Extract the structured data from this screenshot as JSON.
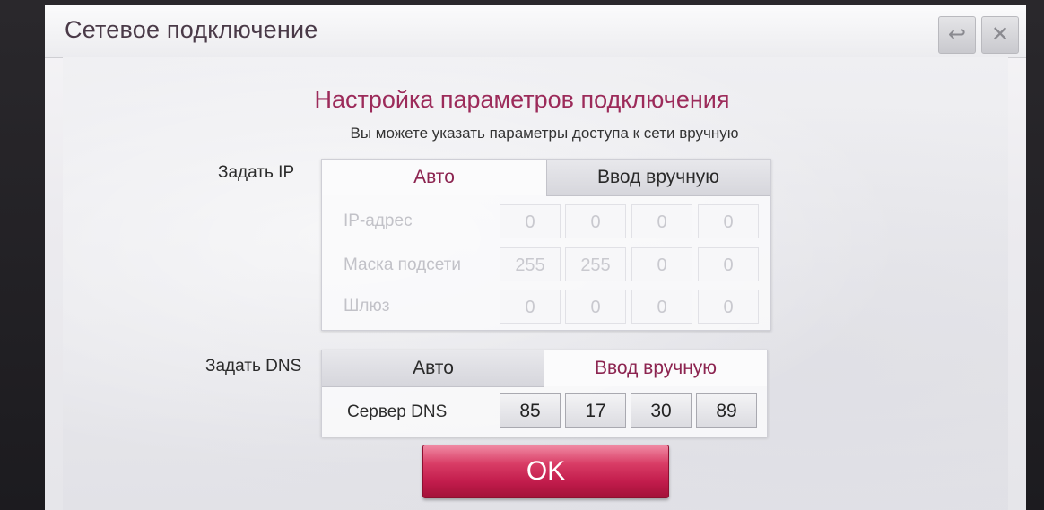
{
  "window": {
    "title": "Сетевое подключение",
    "back_icon": "↩",
    "close_icon": "✕"
  },
  "heading": "Настройка параметров подключения",
  "subheading": "Вы можете указать параметры доступа к сети вручную",
  "ip_section": {
    "label": "Задать IP",
    "tabs": [
      {
        "label": "Авто",
        "selected": true
      },
      {
        "label": "Ввод вручную",
        "selected": false
      }
    ],
    "fields": [
      {
        "label": "IP-адрес",
        "values": [
          "0",
          "0",
          "0",
          "0"
        ]
      },
      {
        "label": "Маска подсети",
        "values": [
          "255",
          "255",
          "0",
          "0"
        ]
      },
      {
        "label": "Шлюз",
        "values": [
          "0",
          "0",
          "0",
          "0"
        ]
      }
    ]
  },
  "dns_section": {
    "label": "Задать DNS",
    "tabs": [
      {
        "label": "Авто",
        "selected": false
      },
      {
        "label": "Ввод вручную",
        "selected": true
      }
    ],
    "server_label": "Сервер DNS",
    "server_values": [
      "85",
      "17",
      "30",
      "89"
    ]
  },
  "ok_label": "OK",
  "colors": {
    "accent": "#9c2b5a",
    "ok_button": "#c21c4c"
  }
}
